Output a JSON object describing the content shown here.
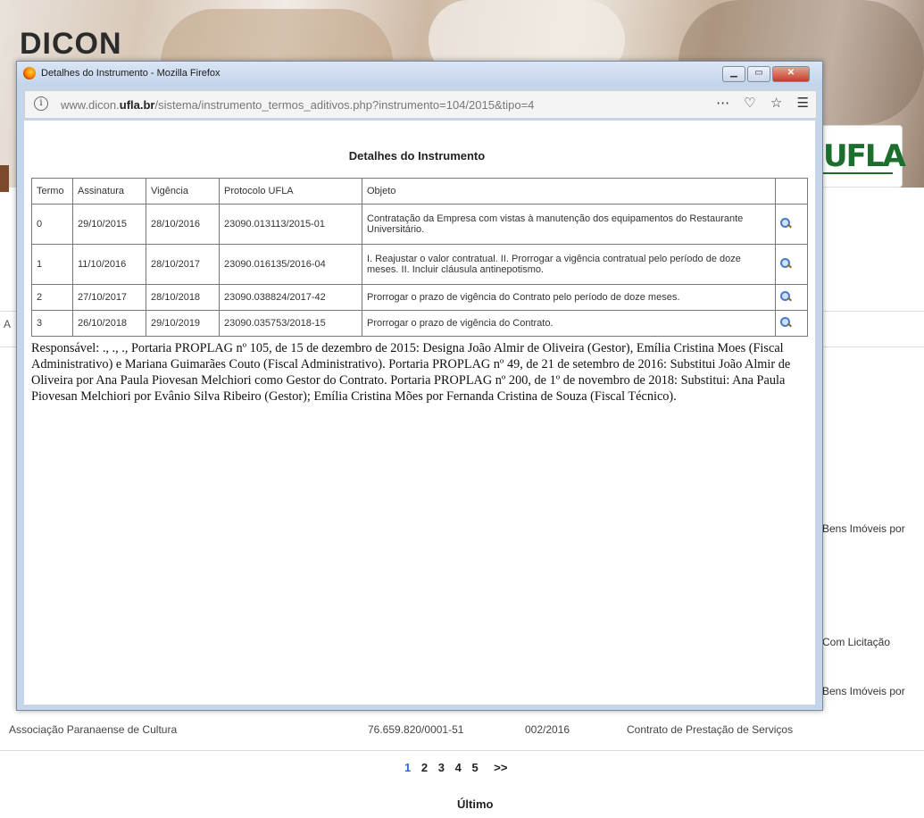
{
  "background": {
    "brand": "DICON",
    "right_fragments": [
      "Bens Imóveis por",
      "Com Licitação",
      "Bens Imóveis por"
    ],
    "left_marker": "A",
    "row": {
      "entity": "Associação Paranaense de Cultura",
      "cnpj": "76.659.820/0001-51",
      "number": "002/2016",
      "type": "Contrato de Prestação de Serviços"
    },
    "pagination": {
      "pages": [
        "1",
        "2",
        "3",
        "4",
        "5"
      ],
      "next": ">>",
      "current": "1",
      "last_label": "Último"
    }
  },
  "popup": {
    "window_title": "Detalhes do Instrumento - Mozilla Firefox",
    "url": {
      "prefix": "www.dicon.",
      "domain": "ufla.br",
      "path": "/sistema/instrumento_termos_aditivos.php?instrumento=104/2015&tipo=4"
    },
    "toolbar_icons": [
      "more-icon",
      "pocket-icon",
      "bookmark-star-icon",
      "menu-icon"
    ],
    "heading": "Detalhes do Instrumento",
    "table": {
      "headers": [
        "Termo",
        "Assinatura",
        "Vigência",
        "Protocolo UFLA",
        "Objeto",
        ""
      ],
      "rows": [
        {
          "termo": "0",
          "assinatura": "29/10/2015",
          "vigencia": "28/10/2016",
          "protocolo": "23090.013113/2015-01",
          "objeto": "Contratação da Empresa com vistas à manutenção dos equipamentos do Restaurante Universitário."
        },
        {
          "termo": "1",
          "assinatura": "11/10/2016",
          "vigencia": "28/10/2017",
          "protocolo": "23090.016135/2016-04",
          "objeto": "I. Reajustar o valor contratual. II. Prorrogar a vigência contratual pelo período de doze meses. II. Incluir cláusula antinepotismo."
        },
        {
          "termo": "2",
          "assinatura": "27/10/2017",
          "vigencia": "28/10/2018",
          "protocolo": "23090.038824/2017-42",
          "objeto": "Prorrogar o prazo de vigência do Contrato pelo período de doze meses."
        },
        {
          "termo": "3",
          "assinatura": "26/10/2018",
          "vigencia": "29/10/2019",
          "protocolo": "23090.035753/2018-15",
          "objeto": "Prorrogar o prazo de vigência do Contrato."
        }
      ]
    },
    "responsavel": "Responsável: ., ., ., Portaria PROPLAG nº 105, de 15 de dezembro de 2015: Designa João Almir de Oliveira (Gestor), Emília Cristina Moes (Fiscal Administrativo) e Mariana Guimarães Couto (Fiscal Administrativo). Portaria PROPLAG nº 49, de 21 de setembro de 2016: Substitui João Almir de Oliveira por Ana Paula Piovesan Melchiori como Gestor do Contrato. Portaria PROPLAG nº 200, de 1º de novembro de 2018: Substitui: Ana Paula Piovesan Melchiori por Evânio Silva Ribeiro (Gestor); Emília Cristina Mões por Fernanda Cristina de Souza (Fiscal Técnico)."
  }
}
